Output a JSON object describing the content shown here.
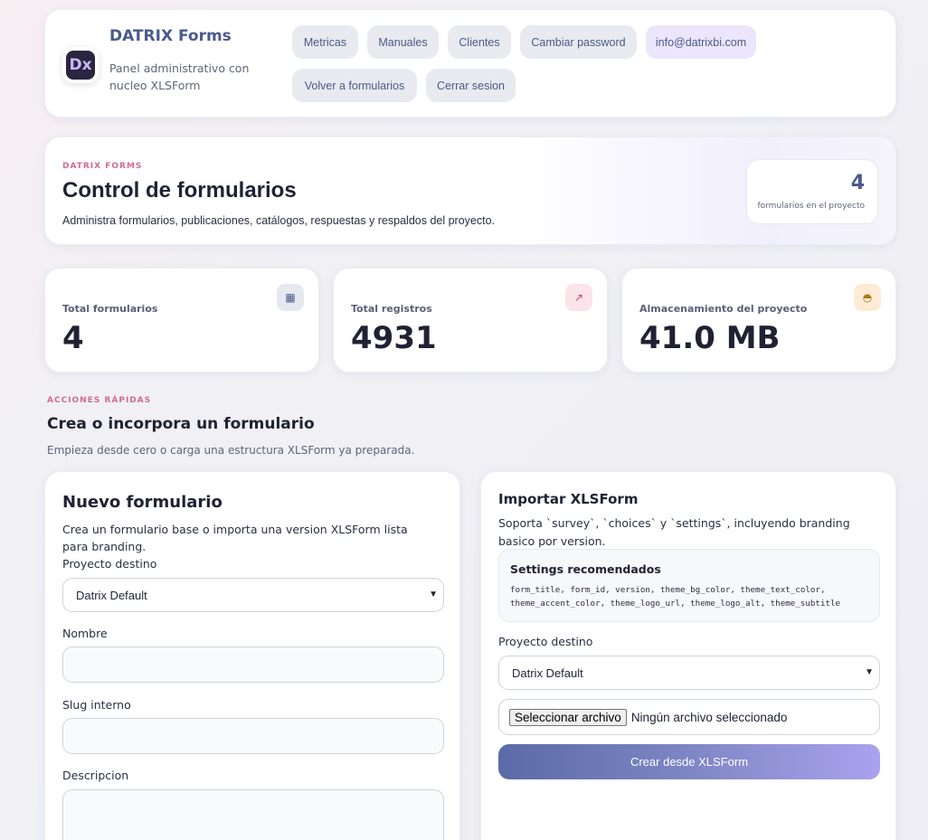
{
  "header": {
    "logo_text": "Dx",
    "brand_title": "DATRIX Forms",
    "brand_subtitle": "Panel administrativo con nucleo XLSForm",
    "nav": {
      "metricas": "Metricas",
      "manuales": "Manuales",
      "clientes": "Clientes",
      "cambiar_password": "Cambiar password",
      "email": "info@datrixbi.com",
      "volver": "Volver a formularios",
      "cerrar": "Cerrar sesion"
    }
  },
  "hero": {
    "kicker": "DATRIX FORMS",
    "title": "Control de formularios",
    "description": "Administra formularios, publicaciones, catálogos, respuestas y respaldos del proyecto.",
    "count": "4",
    "count_label": "formularios en el proyecto"
  },
  "stats": [
    {
      "label": "Total formularios",
      "value": "4",
      "icon": "grid-icon",
      "icon_glyph": "▦",
      "icon_bg": "#e6e8f0",
      "icon_color": "#4a5a8c"
    },
    {
      "label": "Total registros",
      "value": "4931",
      "icon": "trend-arrow-icon",
      "icon_glyph": "↗",
      "icon_bg": "#fbe3ea",
      "icon_color": "#c0426e"
    },
    {
      "label": "Almacenamiento del proyecto",
      "value": "41.0 MB",
      "icon": "storage-disk-icon",
      "icon_glyph": "◓",
      "icon_bg": "#fdebd5",
      "icon_color": "#a9791a"
    }
  ],
  "quick_actions": {
    "kicker": "ACCIONES RÁPIDAS",
    "title": "Crea o incorpora un formulario",
    "description": "Empieza desde cero o carga una estructura XLSForm ya preparada."
  },
  "new_form": {
    "title": "Nuevo formulario",
    "description": "Crea un formulario base o importa una version XLSForm lista para branding.",
    "project_label": "Proyecto destino",
    "project_value": "Datrix Default",
    "name_label": "Nombre",
    "name_value": "",
    "slug_label": "Slug interno",
    "slug_value": "",
    "description_label": "Descripcion",
    "description_value": ""
  },
  "import_form": {
    "title": "Importar XLSForm",
    "description": "Soporta `survey`, `choices` y `settings`, incluyendo branding basico por version.",
    "settings_title": "Settings recomendados",
    "settings_code": "form_title, form_id, version, theme_bg_color, theme_text_color, theme_accent_color, theme_logo_url, theme_logo_alt, theme_subtitle",
    "project_label": "Proyecto destino",
    "project_value": "Datrix Default",
    "file_button": "Seleccionar archivo",
    "file_status": "Ningún archivo seleccionado",
    "submit_label": "Crear desde XLSForm"
  },
  "colors": {
    "accent": "#4a5a8c",
    "kicker": "#d16a93",
    "primary_gradient_start": "#5b6aa8",
    "primary_gradient_end": "#aaa2ee"
  }
}
